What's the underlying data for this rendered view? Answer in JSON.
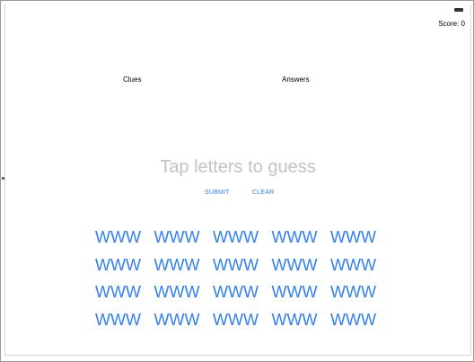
{
  "status_bar": {
    "battery_icon": "battery-icon"
  },
  "score": {
    "label": "Score: 0"
  },
  "labels": {
    "clues": "Clues",
    "answers": "Answers"
  },
  "guess": {
    "placeholder": "Tap letters to guess",
    "value": ""
  },
  "buttons": {
    "submit": "SUBMIT",
    "clear": "CLEAR"
  },
  "letter_buttons": [
    "WWW",
    "WWW",
    "WWW",
    "WWW",
    "WWW",
    "WWW",
    "WWW",
    "WWW",
    "WWW",
    "WWW",
    "WWW",
    "WWW",
    "WWW",
    "WWW",
    "WWW",
    "WWW",
    "WWW",
    "WWW",
    "WWW",
    "WWW"
  ],
  "colors": {
    "accent": "#2f7ef6",
    "placeholder": "#c2c2c7",
    "text": "#000000"
  }
}
